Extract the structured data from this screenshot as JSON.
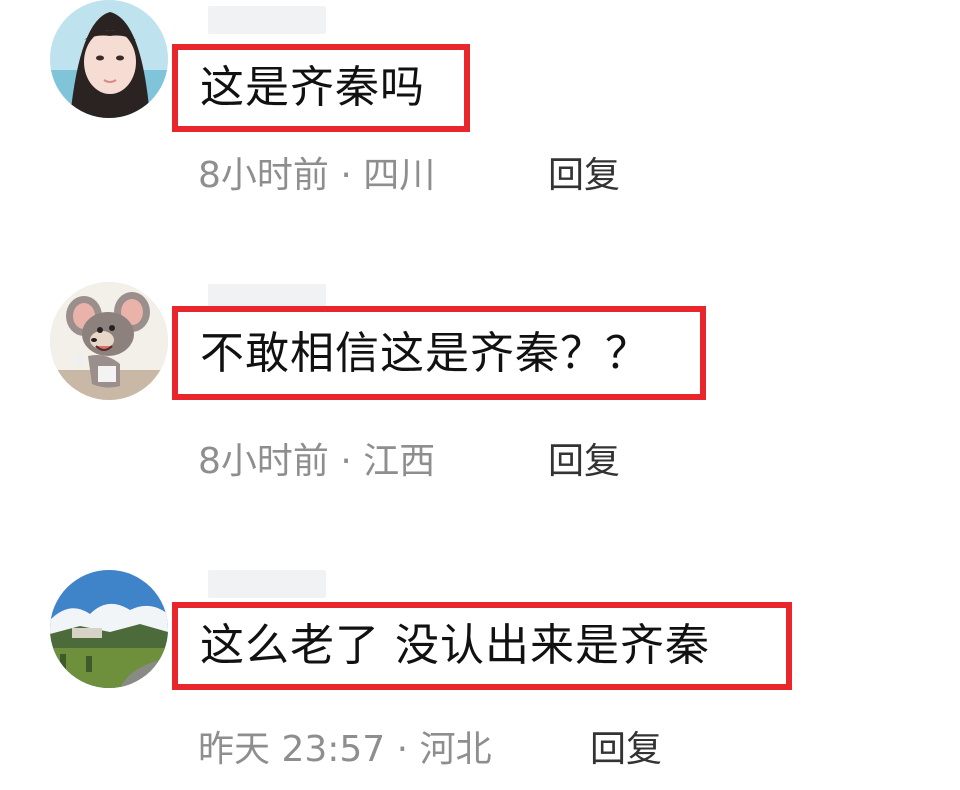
{
  "comments": [
    {
      "avatar_icon": "girl-avatar-icon",
      "text": "这是齐秦吗",
      "time": "8小时前",
      "separator": "·",
      "location": "四川",
      "reply_label": "回复"
    },
    {
      "avatar_icon": "cartoon-mouse-avatar-icon",
      "text": "不敢相信这是齐秦？？",
      "time": "8小时前",
      "separator": "·",
      "location": "江西",
      "reply_label": "回复"
    },
    {
      "avatar_icon": "landscape-avatar-icon",
      "text": "这么老了 没认出来是齐秦",
      "time": "昨天 23:57",
      "separator": "·",
      "location": "河北",
      "reply_label": "回复"
    }
  ],
  "colors": {
    "highlight_border": "#e8262b",
    "meta_text": "#8e8e8e",
    "reply_text": "#333333",
    "comment_text": "#111111"
  }
}
